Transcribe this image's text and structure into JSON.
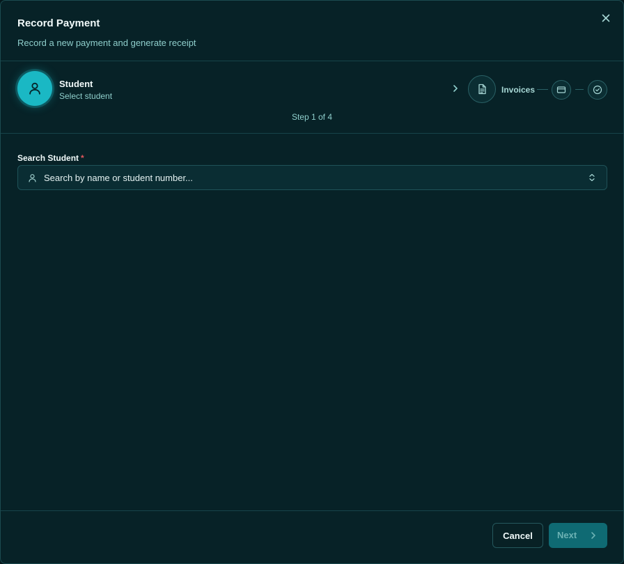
{
  "dialog": {
    "title": "Record Payment",
    "subtitle": "Record a new payment and generate receipt"
  },
  "stepper": {
    "active_step": {
      "label": "Student",
      "description": "Select student",
      "icon": "user-icon"
    },
    "steps": [
      {
        "label": "Invoices",
        "icon": "document-icon"
      },
      {
        "label": "",
        "icon": "credit-card-icon"
      },
      {
        "label": "",
        "icon": "check-circle-icon"
      }
    ],
    "progress_text": "Step 1 of 4"
  },
  "form": {
    "search_label": "Search Student",
    "required_mark": "*",
    "search_placeholder": "Search by name or student number..."
  },
  "footer": {
    "cancel_label": "Cancel",
    "next_label": "Next"
  },
  "colors": {
    "background": "#072227",
    "accent": "#1ab8c4",
    "next_button": "#0f6a73",
    "required": "#e0565b"
  }
}
